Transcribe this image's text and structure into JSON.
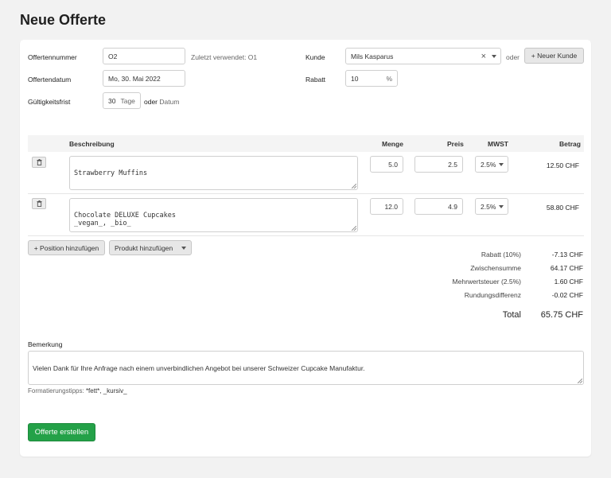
{
  "page_title": "Neue Offerte",
  "form": {
    "offer_number": {
      "label": "Offertennummer",
      "value": "O2",
      "hint": "Zuletzt verwendet: O1"
    },
    "offer_date": {
      "label": "Offertendatum",
      "value": "Mo, 30. Mai 2022"
    },
    "validity": {
      "label": "Gültigkeitsfrist",
      "value": "30",
      "unit": "Tage",
      "or_text": "oder",
      "alt_link": "Datum"
    },
    "customer": {
      "label": "Kunde",
      "value": "Mils Kasparus",
      "clear": "×",
      "or_text": "oder",
      "new_button": "+ Neuer Kunde"
    },
    "discount": {
      "label": "Rabatt",
      "value": "10",
      "unit": "%"
    }
  },
  "table": {
    "headers": {
      "description": "Beschreibung",
      "quantity": "Menge",
      "price": "Preis",
      "vat": "MWST",
      "amount": "Betrag"
    },
    "rows": [
      {
        "description": "Strawberry Muffins",
        "quantity": "5.0",
        "price": "2.5",
        "vat": "2.5%",
        "amount": "12.50 CHF"
      },
      {
        "description": "Chocolate DELUXE Cupcakes\n_vegan_, _bio_",
        "quantity": "12.0",
        "price": "4.9",
        "vat": "2.5%",
        "amount": "58.80 CHF"
      }
    ]
  },
  "actions": {
    "add_position": "+ Position hinzufügen",
    "add_product": "Produkt hinzufügen"
  },
  "summary": {
    "discount_label": "Rabatt (10%)",
    "discount_value": "-7.13 CHF",
    "subtotal_label": "Zwischensumme",
    "subtotal_value": "64.17 CHF",
    "vat_label": "Mehrwertsteuer (2.5%)",
    "vat_value": "1.60 CHF",
    "rounding_label": "Rundungsdifferenz",
    "rounding_value": "-0.02 CHF",
    "total_label": "Total",
    "total_value": "65.75 CHF"
  },
  "remark": {
    "label": "Bemerkung",
    "value": "Vielen Dank für Ihre Anfrage nach einem unverbindlichen Angebot bei unserer Schweizer Cupcake Manufaktur.",
    "tips_prefix": "Formatierungstipps:",
    "tips": "*fett*, _kursiv_"
  },
  "submit_button": "Offerte erstellen",
  "colors": {
    "primary": "#24a148",
    "background": "#f2f2f2"
  }
}
